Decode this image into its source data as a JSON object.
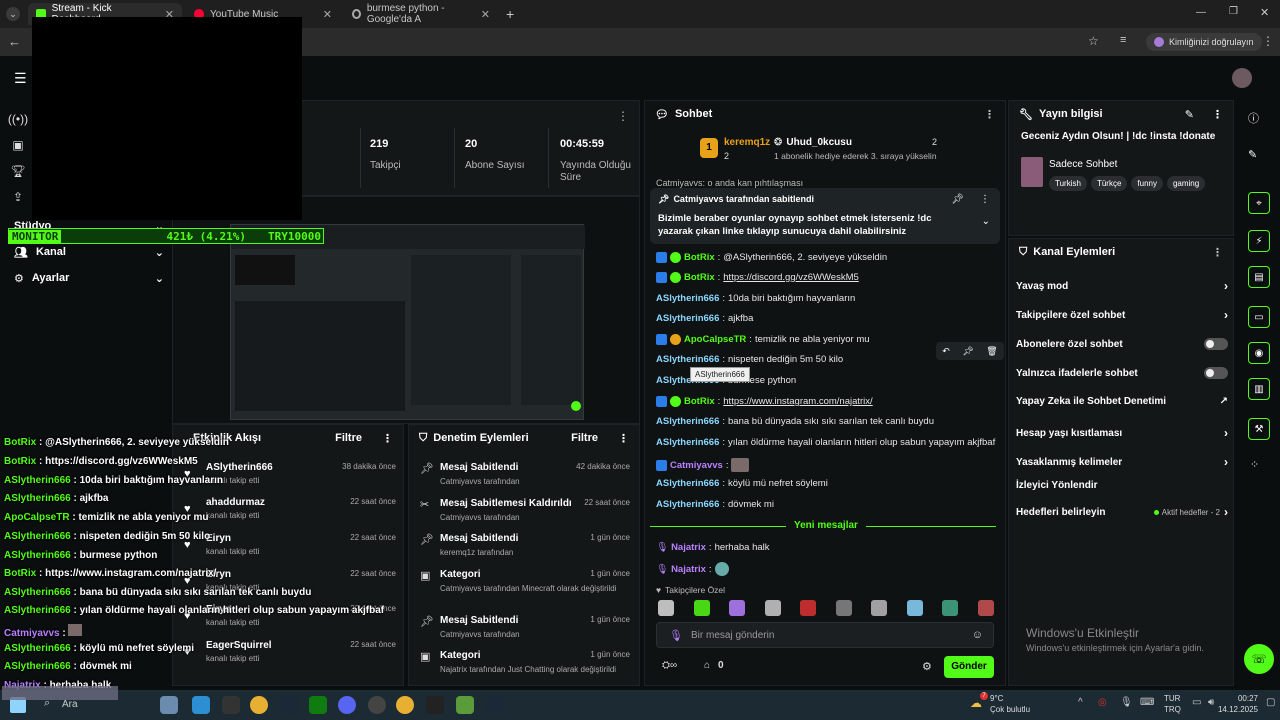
{
  "tabs": [
    {
      "label": "Stream - Kick Dashboard"
    },
    {
      "label": "YouTube Music"
    },
    {
      "label": "burmese python - Google'da A"
    }
  ],
  "addr": {
    "verify_label": "Kimliğinizi doğrulayın"
  },
  "stats": [
    {
      "value": "219",
      "label": "Takipçi"
    },
    {
      "value": "20",
      "label": "Abone Sayısı"
    },
    {
      "value": "00:45:59",
      "label": "Yayında Olduğu Süre"
    }
  ],
  "stat_partial": "ci",
  "sidebar": {
    "items": [
      {
        "label": "Stüdyo"
      },
      {
        "label": "Kanal"
      },
      {
        "label": "Ayarlar"
      }
    ]
  },
  "monitor": {
    "label": "MONITOR",
    "value": "421₺ (4.21%)",
    "goal": "TRY10000"
  },
  "chat": {
    "title": "Sohbet",
    "leader1": {
      "name": "keremq1z",
      "rank": "1",
      "count": "2"
    },
    "leader2": {
      "name": "Uhud_0kcusu",
      "count": "2",
      "note": "1 abonelik hediye ederek 3. sıraya yükselin"
    },
    "cut_line": "Catmiyavvs: o anda kan pıhtılaşması",
    "pinned_by": "Catmiyavvs tarafından sabitlendi",
    "pinned_text": "Bizimle beraber oyunlar oynayıp sohbet etmek isterseniz !dc yazarak çıkan linke tıklayıp sunucuya dahil olabilirsiniz",
    "messages": [
      {
        "user": "BotRix",
        "text": "@ASlytherin666, 2. seviyeye yükseldin"
      },
      {
        "user": "BotRix",
        "text": "https://discord.gg/vz6WWeskM5"
      },
      {
        "user": "ASlytherin666",
        "text": "10da biri baktığım hayvanların"
      },
      {
        "user": "ASlytherin666",
        "text": "ajkfba"
      },
      {
        "user": "ApoCalpseTR",
        "text": "temizlik ne abla yeniyor mu"
      },
      {
        "user": "ASlytherin666",
        "text": "nispeten dediğin 5m 50 kilo"
      },
      {
        "user": "ASlytherin666",
        "text": "burmese python"
      },
      {
        "user": "BotRix",
        "text": "https://www.instagram.com/najatrix/"
      },
      {
        "user": "ASlytherin666",
        "text": "bana bü dünyada sıkı sıkı sarılan tek canlı buydu"
      },
      {
        "user": "ASlytherin666",
        "text": "yılan öldürme hayali olanların hitleri olup sabun yapayım akjfbaf"
      },
      {
        "user": "Catmiyavvs",
        "text": ""
      },
      {
        "user": "ASlytherin666",
        "text": "köylü mü nefret söylemi"
      },
      {
        "user": "ASlytherin666",
        "text": "dövmek mi"
      }
    ],
    "tooltip": "ASlytherin666",
    "new_messages": "Yeni mesajlar",
    "new": [
      {
        "user": "Najatrix",
        "text": "herhaba halk"
      },
      {
        "user": "Najatrix",
        "text": ""
      }
    ],
    "followers_label": "Takipçilere Özel",
    "input_placeholder": "Bir mesaj gönderin",
    "count": "0",
    "send": "Gönder"
  },
  "stream_info": {
    "title": "Yayın bilgisi",
    "stream_title": "Geceniz Aydın Olsun! | !dc !insta !donate",
    "category": "Sadece Sohbet",
    "tags": [
      "Turkish",
      "Türkçe",
      "funny",
      "gaming"
    ]
  },
  "channel_actions": {
    "title": "Kanal Eylemleri",
    "items": [
      {
        "label": "Yavaş mod"
      },
      {
        "label": "Takipçilere özel sohbet"
      },
      {
        "label": "Abonelere özel sohbet"
      },
      {
        "label": "Yalnızca ifadelerle sohbet"
      },
      {
        "label": "Yapay Zeka ile Sohbet Denetimi"
      },
      {
        "label": "Hesap yaşı kısıtlaması"
      },
      {
        "label": "Yasaklanmış kelimeler"
      },
      {
        "label": "İzleyici Yönlendir"
      },
      {
        "label": "Hedefleri belirleyin"
      }
    ],
    "goal_status": "Aktif hedefler - 2"
  },
  "activity": {
    "title": "Etkinlik Akışı",
    "filter": "Filtre",
    "items": [
      {
        "user": "ASlytherin666",
        "sub": "kanalı takip etti",
        "when": "38 dakika önce"
      },
      {
        "user": "ahaddurmaz",
        "sub": "kanalı takip etti",
        "when": "22 saat önce"
      },
      {
        "user": "Eiryn",
        "sub": "kanalı takip etti",
        "when": "22 saat önce"
      },
      {
        "user": "Eiryn",
        "sub": "kanalı takip etti",
        "when": "22 saat önce"
      },
      {
        "user": "Eiryn",
        "sub": "kanalı takip etti",
        "when": "22 saat önce"
      },
      {
        "user": "EagerSquirrel",
        "sub": "kanalı takip etti",
        "when": "22 saat önce"
      }
    ]
  },
  "moderation": {
    "title": "Denetim Eylemleri",
    "filter": "Filtre",
    "items": [
      {
        "title": "Mesaj Sabitlendi",
        "sub": "Catmiyavvs tarafından",
        "when": "42 dakika önce"
      },
      {
        "title": "Mesaj Sabitlemesi Kaldırıldı",
        "sub": "Catmiyavvs tarafından",
        "when": "22 saat önce"
      },
      {
        "title": "Mesaj Sabitlendi",
        "sub": "keremq1z tarafından",
        "when": "1 gün önce"
      },
      {
        "title": "Kategori",
        "sub": "Catmiyavvs tarafından Minecraft olarak değiştirildi",
        "when": "1 gün önce"
      },
      {
        "title": "Mesaj Sabitlendi",
        "sub": "Catmiyavvs tarafından",
        "when": "1 gün önce"
      },
      {
        "title": "Kategori",
        "sub": "Najatrix tarafından Just Chatting olarak değiştirildi",
        "when": "1 gün önce"
      }
    ]
  },
  "overlay_chat": [
    {
      "user": "BotRix",
      "text": "@ASlytherin666, 2. seviyeye yükseldin"
    },
    {
      "user": "BotRix",
      "text": "https://discord.gg/vz6WWeskM5"
    },
    {
      "user": "ASlytherin666",
      "text": "10da biri baktığım hayvanların"
    },
    {
      "user": "ASlytherin666",
      "text": "ajkfba"
    },
    {
      "user": "ApoCalpseTR",
      "text": "temizlik ne abla yeniyor mu"
    },
    {
      "user": "ASlytherin666",
      "text": "nispeten dediğin 5m 50 kilo"
    },
    {
      "user": "ASlytherin666",
      "text": "burmese python"
    },
    {
      "user": "BotRix",
      "text": "https://www.instagram.com/najatrix/"
    },
    {
      "user": "ASlytherin666",
      "text": "bana bü dünyada sıkı sıkı sarılan tek canlı buydu"
    },
    {
      "user": "ASlytherin666",
      "text": "yılan öldürme hayali olanların hitleri olup sabun yapayım akjfbaf"
    },
    {
      "user": "Catmiyavvs",
      "text": ""
    },
    {
      "user": "ASlytherin666",
      "text": "köylü mü nefret söylemi"
    },
    {
      "user": "ASlytherin666",
      "text": "dövmek mi"
    },
    {
      "user": "Najatrix",
      "text": "herhaba halk"
    }
  ],
  "windows": {
    "activate_title": "Windows'u Etkinleştir",
    "activate_sub": "Windows'u etkinleştirmek için Ayarlar'a gidin."
  },
  "taskbar": {
    "search": "Ara",
    "weather": "9°C",
    "weather_desc": "Çok bulutlu",
    "lang": "TUR",
    "lang2": "TRQ",
    "time": "00:27",
    "date": "14.12.2025",
    "notif": "7"
  },
  "colors": {
    "accent": "#53fc18",
    "bg": "#0b0e0f",
    "panel": "#141718"
  }
}
